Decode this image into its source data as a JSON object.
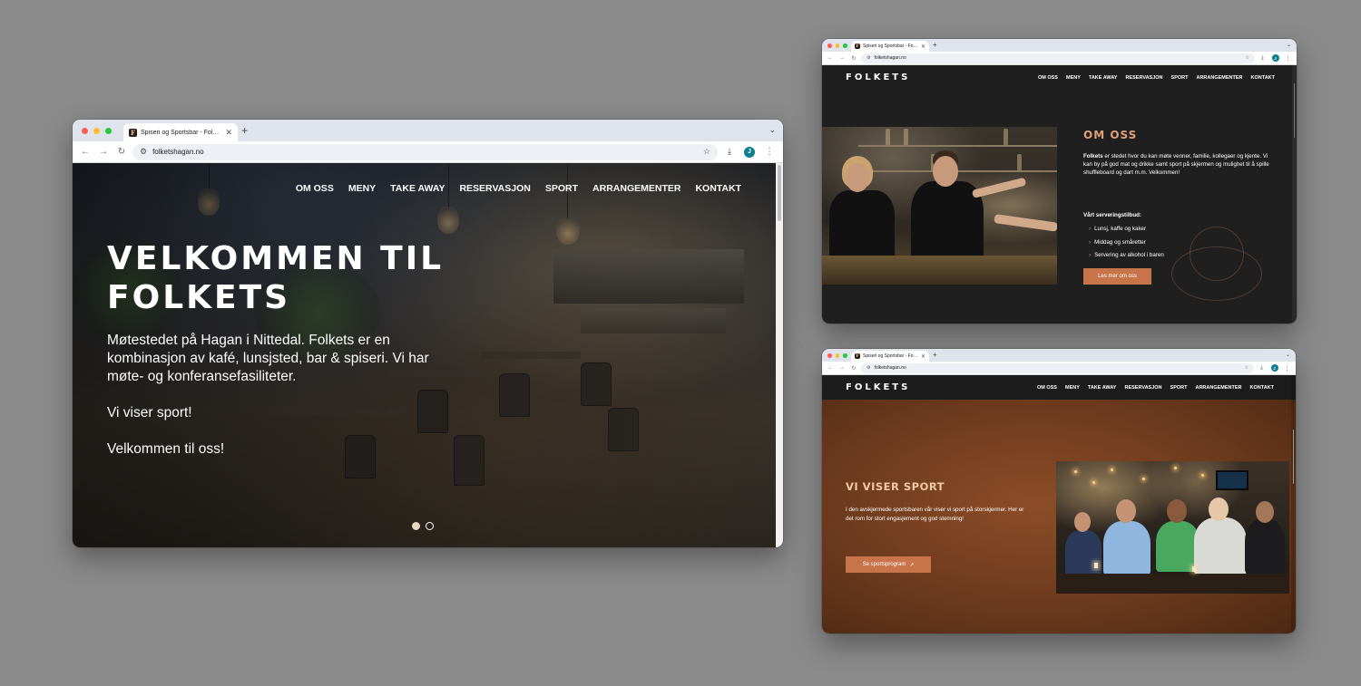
{
  "colors": {
    "accent": "#c8744a",
    "heading_accent": "#e0a07a",
    "dark_bg": "#1f1f20",
    "sport_bg": "#7a4220"
  },
  "browser": {
    "tab_title": "Spiseri og Sportsbar - Folkets",
    "url": "folketshagan.no",
    "avatar_letter": "J"
  },
  "site": {
    "logo": "FOLKETS",
    "nav": [
      "OM OSS",
      "MENY",
      "TAKE AWAY",
      "RESERVASJON",
      "SPORT",
      "ARRANGEMENTER",
      "KONTAKT"
    ]
  },
  "hero": {
    "title_line1": "VELKOMMEN TIL",
    "title_line2": "FOLKETS",
    "paragraph": "Møtestedet på Hagan i Nittedal. Folkets er en kombinasjon av kafé, lunsjsted, bar & spiseri. Vi har møte- og konferansefasiliteter.",
    "sport_line": "Vi viser sport!",
    "welcome_line": "Velkommen til oss!",
    "slides_total": 2,
    "slide_active": 1
  },
  "om_oss": {
    "title": "OM OSS",
    "text_bold": "Folkets",
    "text_rest": " er stedet hvor du kan møte venner, familie, kollegaer og kjente. Vi kan by på god mat og drikke samt sport på skjermen og mulighet til å spille shuffleboard og dart m.m. Velkommen!",
    "services_title": "Vårt serveringstilbud:",
    "services": [
      "Lunsj, kaffe og kaker",
      "Middag og småretter",
      "Servering av alkohol i baren"
    ],
    "button": "Les mer om oss"
  },
  "sport": {
    "title": "VI VISER SPORT",
    "text": "I den avskjermede sportsbaren vår viser vi sport på storskjermer. Her er det rom for stort engasjement og god stemning!",
    "button": "Se sportsprogram"
  }
}
